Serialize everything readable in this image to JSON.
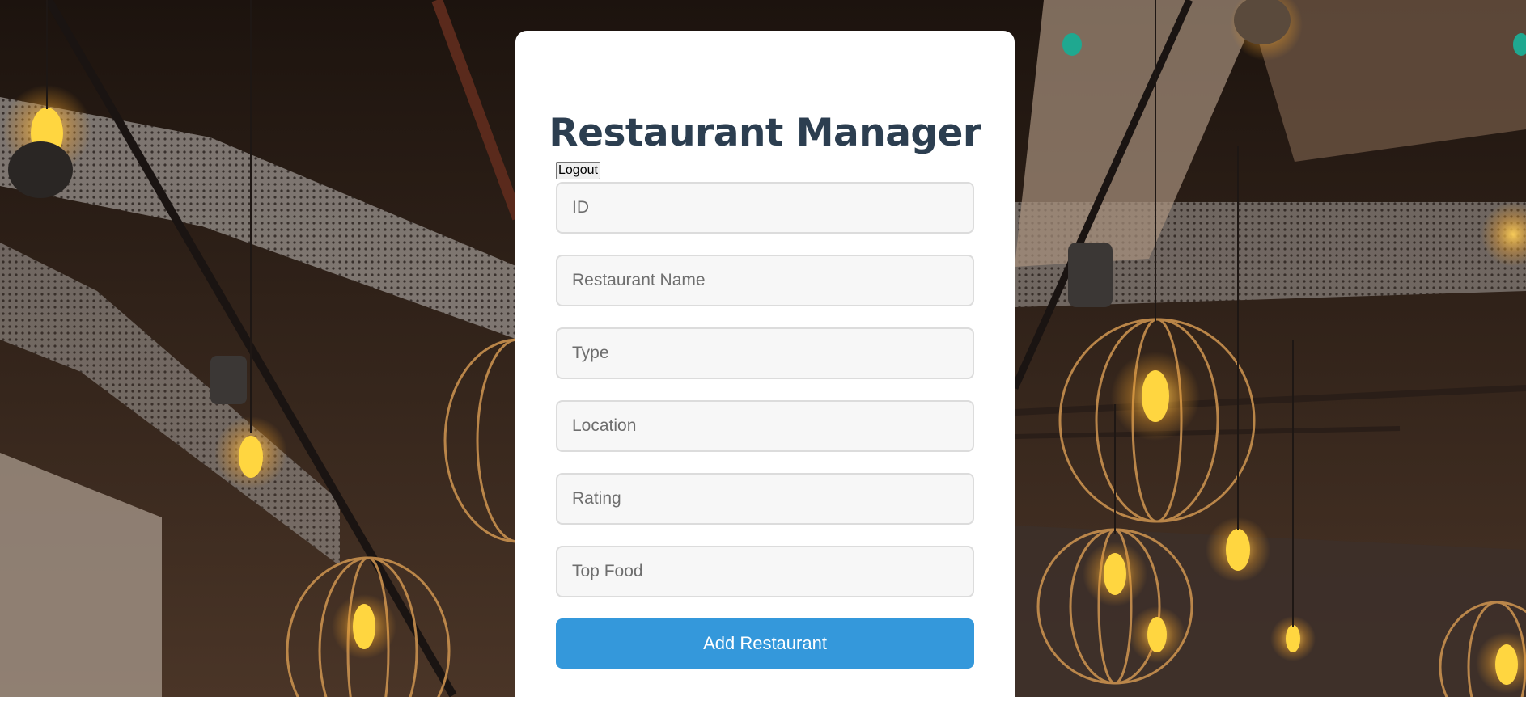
{
  "app": {
    "title": "Restaurant Manager"
  },
  "auth": {
    "logout_label": "Logout"
  },
  "form": {
    "fields": [
      {
        "key": "id",
        "placeholder": "ID",
        "value": ""
      },
      {
        "key": "name",
        "placeholder": "Restaurant Name",
        "value": ""
      },
      {
        "key": "type",
        "placeholder": "Type",
        "value": ""
      },
      {
        "key": "location",
        "placeholder": "Location",
        "value": ""
      },
      {
        "key": "rating",
        "placeholder": "Rating",
        "value": ""
      },
      {
        "key": "top_food",
        "placeholder": "Top Food",
        "value": ""
      }
    ],
    "submit_label": "Add Restaurant"
  },
  "colors": {
    "title": "#2c3e50",
    "primary_button": "#3498db",
    "card": "#ffffff",
    "input_bg": "#f7f7f7",
    "input_border": "#dcdcdc"
  },
  "background": {
    "icon": "restaurant-interior-photo"
  }
}
